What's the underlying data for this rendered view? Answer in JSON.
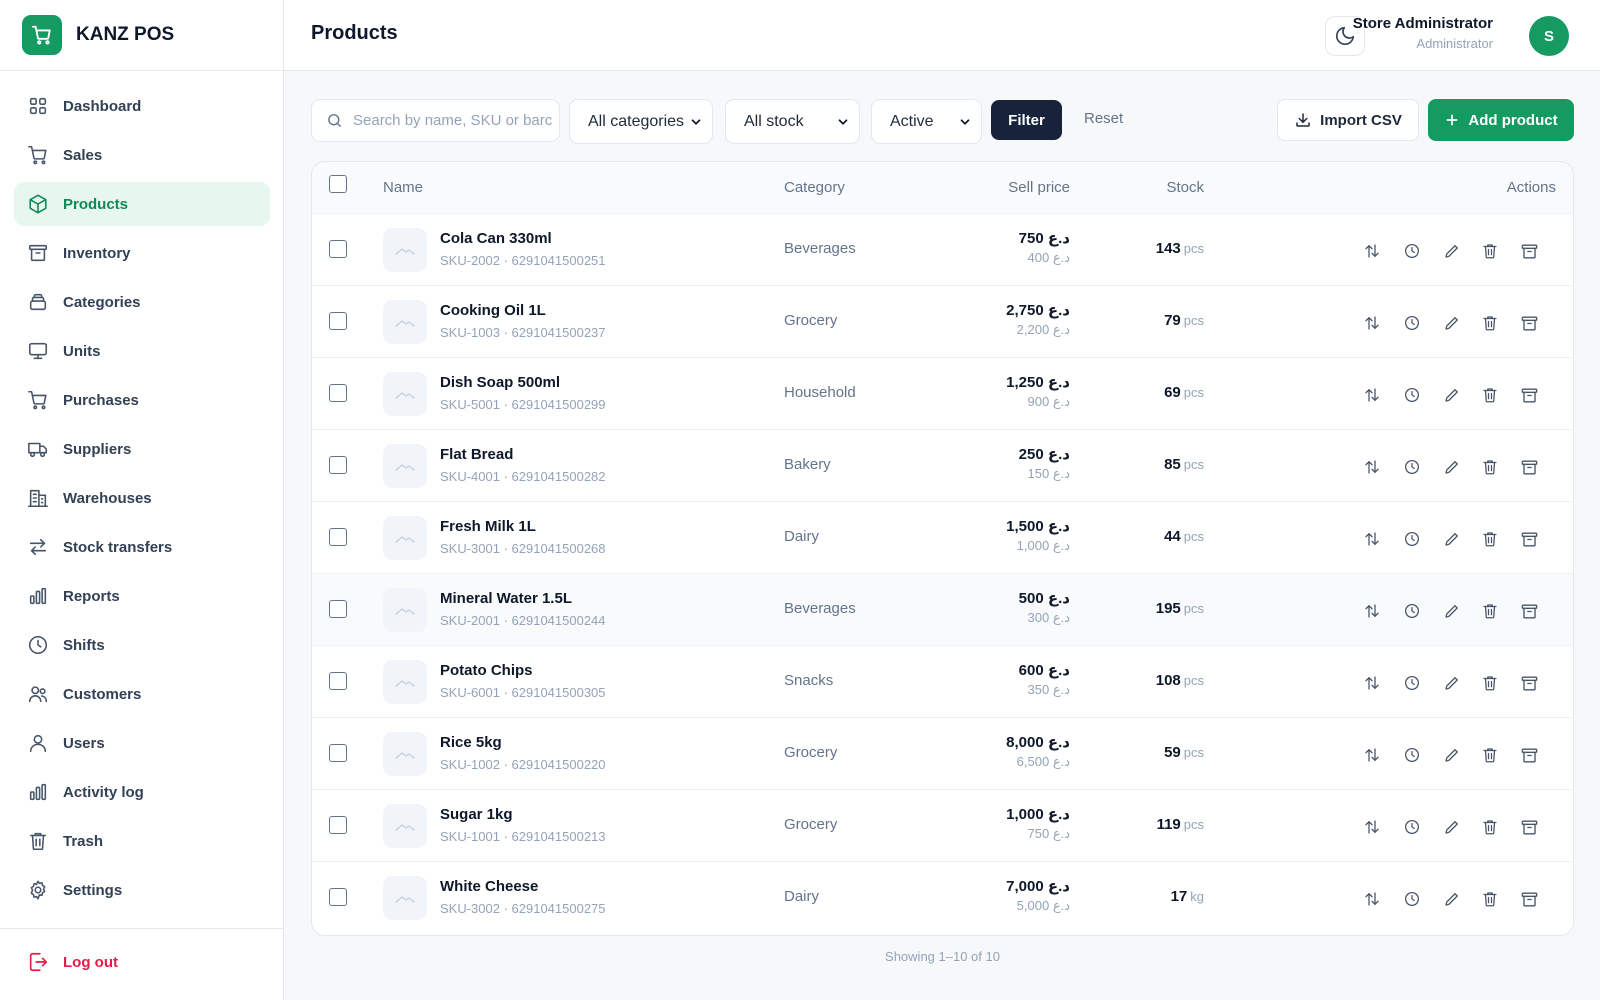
{
  "app": {
    "name": "KANZ POS"
  },
  "colors": {
    "brand": "#159a62",
    "active_bg": "#e7f7ef",
    "filter_btn": "#17233a",
    "logout": "#e11d48"
  },
  "sidebar": {
    "items": [
      {
        "label": "Dashboard",
        "icon": "dashboard-icon",
        "active": false
      },
      {
        "label": "Sales",
        "icon": "cart-icon",
        "active": false
      },
      {
        "label": "Products",
        "icon": "box-icon",
        "active": true
      },
      {
        "label": "Inventory",
        "icon": "archive-icon",
        "active": false
      },
      {
        "label": "Categories",
        "icon": "layers-icon",
        "active": false
      },
      {
        "label": "Units",
        "icon": "monitor-icon",
        "active": false
      },
      {
        "label": "Purchases",
        "icon": "cart-icon",
        "active": false
      },
      {
        "label": "Suppliers",
        "icon": "truck-icon",
        "active": false
      },
      {
        "label": "Warehouses",
        "icon": "building-icon",
        "active": false
      },
      {
        "label": "Stock transfers",
        "icon": "transfer-icon",
        "active": false
      },
      {
        "label": "Reports",
        "icon": "bar-chart-icon",
        "active": false
      },
      {
        "label": "Shifts",
        "icon": "clock-icon",
        "active": false
      },
      {
        "label": "Customers",
        "icon": "users-icon",
        "active": false
      },
      {
        "label": "Users",
        "icon": "user-icon",
        "active": false
      },
      {
        "label": "Activity log",
        "icon": "bar-chart-icon",
        "active": false
      },
      {
        "label": "Trash",
        "icon": "trash-icon",
        "active": false
      },
      {
        "label": "Settings",
        "icon": "gear-icon",
        "active": false
      }
    ],
    "logout_label": "Log out"
  },
  "header": {
    "title": "Products",
    "user_name": "Store Administrator",
    "user_role": "Administrator",
    "avatar_initial": "S"
  },
  "toolbar": {
    "search_placeholder": "Search by name, SKU or barcode",
    "category_filter": "All categories",
    "stock_filter": "All stock",
    "status_filter": "Active",
    "filter_label": "Filter",
    "reset_label": "Reset",
    "import_label": "Import CSV",
    "add_label": "Add product"
  },
  "table": {
    "columns": {
      "name": "Name",
      "category": "Category",
      "price": "Sell price",
      "stock": "Stock",
      "actions": "Actions"
    },
    "rows": [
      {
        "name": "Cola Can 330ml",
        "sku": "SKU-2002 · 6291041500251",
        "category": "Beverages",
        "sell": "750 د.ع",
        "cost": "400 د.ع",
        "stock": "143",
        "unit": "pcs"
      },
      {
        "name": "Cooking Oil 1L",
        "sku": "SKU-1003 · 6291041500237",
        "category": "Grocery",
        "sell": "2,750 د.ع",
        "cost": "2,200 د.ع",
        "stock": "79",
        "unit": "pcs"
      },
      {
        "name": "Dish Soap 500ml",
        "sku": "SKU-5001 · 6291041500299",
        "category": "Household",
        "sell": "1,250 د.ع",
        "cost": "900 د.ع",
        "stock": "69",
        "unit": "pcs"
      },
      {
        "name": "Flat Bread",
        "sku": "SKU-4001 · 6291041500282",
        "category": "Bakery",
        "sell": "250 د.ع",
        "cost": "150 د.ع",
        "stock": "85",
        "unit": "pcs"
      },
      {
        "name": "Fresh Milk 1L",
        "sku": "SKU-3001 · 6291041500268",
        "category": "Dairy",
        "sell": "1,500 د.ع",
        "cost": "1,000 د.ع",
        "stock": "44",
        "unit": "pcs"
      },
      {
        "name": "Mineral Water 1.5L",
        "sku": "SKU-2001 · 6291041500244",
        "category": "Beverages",
        "sell": "500 د.ع",
        "cost": "300 د.ع",
        "stock": "195",
        "unit": "pcs"
      },
      {
        "name": "Potato Chips",
        "sku": "SKU-6001 · 6291041500305",
        "category": "Snacks",
        "sell": "600 د.ع",
        "cost": "350 د.ع",
        "stock": "108",
        "unit": "pcs"
      },
      {
        "name": "Rice 5kg",
        "sku": "SKU-1002 · 6291041500220",
        "category": "Grocery",
        "sell": "8,000 د.ع",
        "cost": "6,500 د.ع",
        "stock": "59",
        "unit": "pcs"
      },
      {
        "name": "Sugar 1kg",
        "sku": "SKU-1001 · 6291041500213",
        "category": "Grocery",
        "sell": "1,000 د.ع",
        "cost": "750 د.ع",
        "stock": "119",
        "unit": "pcs"
      },
      {
        "name": "White Cheese",
        "sku": "SKU-3002 · 6291041500275",
        "category": "Dairy",
        "sell": "7,000 د.ع",
        "cost": "5,000 د.ع",
        "stock": "17",
        "unit": "kg"
      }
    ],
    "highlighted_row": 5,
    "row_actions": [
      "adjust-stock-icon",
      "history-icon",
      "edit-icon",
      "delete-icon",
      "archive-icon"
    ]
  },
  "pagination": {
    "text": "Showing 1–10 of 10"
  }
}
